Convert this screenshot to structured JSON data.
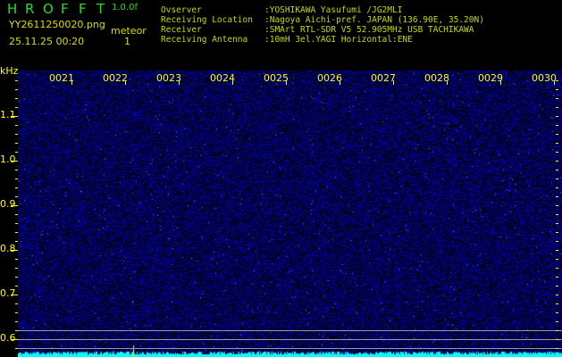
{
  "header": {
    "app_title": [
      "H",
      "R",
      "O",
      "F",
      "F",
      "T"
    ],
    "version": "1.0.0f",
    "filename": "YY2611250020.png",
    "datetime": "25.11.25 00:20",
    "mode_label": "meteor",
    "meteor_count": "1"
  },
  "info": [
    {
      "key": "Ovserver",
      "value": ":YOSHIKAWA Yasufumi /JG2MLI"
    },
    {
      "key": "Receiving Location",
      "value": ":Nagoya Aichi-pref. JAPAN (136.90E, 35.20N)"
    },
    {
      "key": "Receiver",
      "value": ":SMArt RTL-SDR V5 52.905MHz USB TACHIKAWA"
    },
    {
      "key": "Receiving Antenna",
      "value": ":10mH 3el.YAGI Horizontal:ENE"
    }
  ],
  "spectrogram": {
    "y_unit": "kHz",
    "y_ticks": [
      "1.1",
      "1.0",
      "0.9",
      "0.8",
      "0.7",
      "0.6"
    ],
    "time_labels": [
      "0021",
      "0022",
      "0023",
      "0024",
      "0025",
      "0026",
      "0027",
      "0028",
      "0029",
      "0030"
    ],
    "colors": {
      "background": "#000000",
      "noise": "#1a1aff",
      "spectrum": "#00ffff",
      "axis": "#ffff00"
    }
  }
}
